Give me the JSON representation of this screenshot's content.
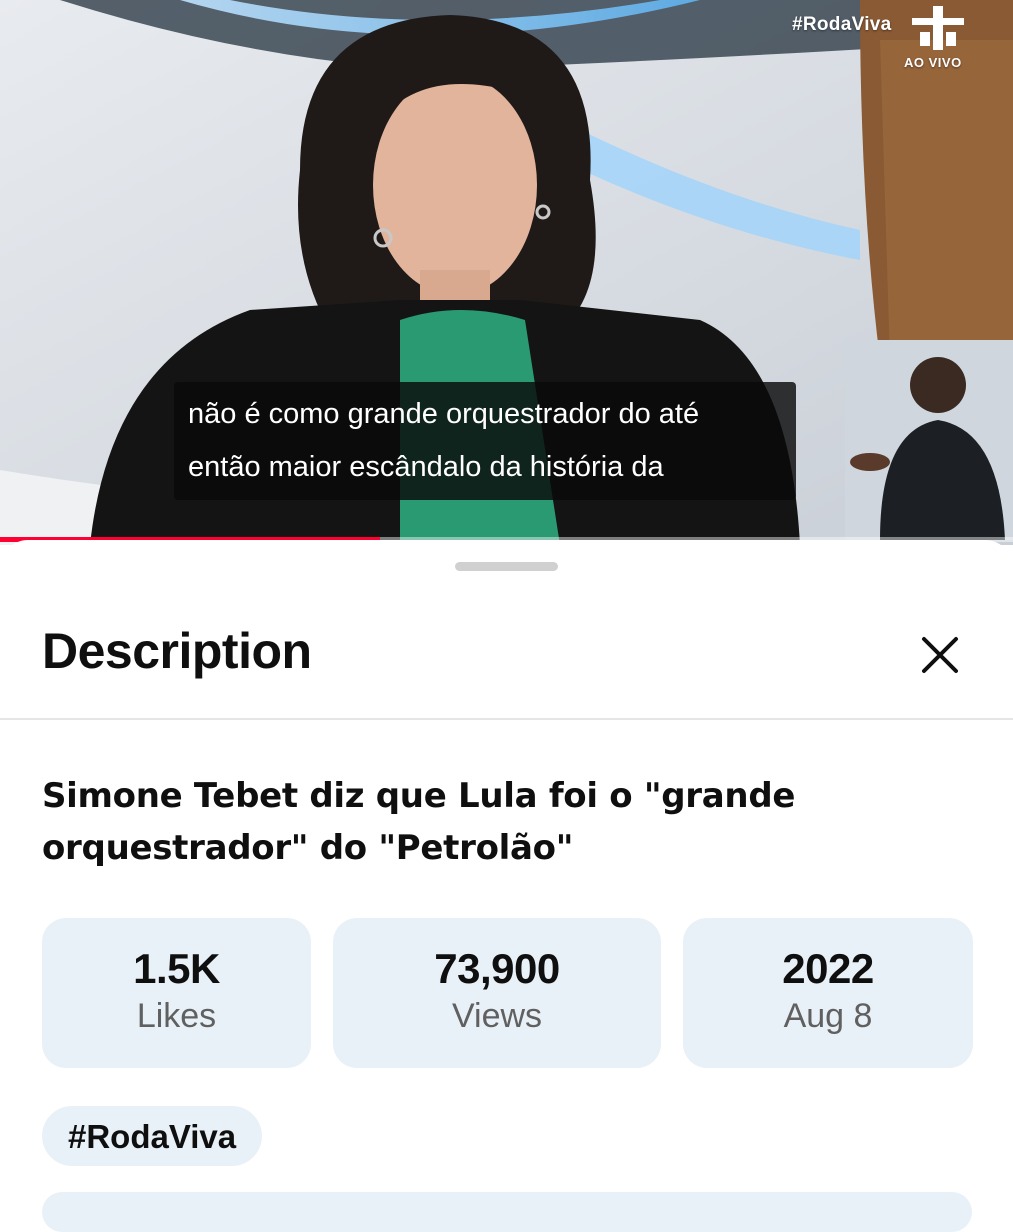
{
  "video": {
    "overlay_hashtag": "#RodaViva",
    "live_label": "AO VIVO",
    "caption_lines": [
      "não é como grande orquestrador do até",
      "então maior escândalo da história da"
    ],
    "progress": 0.375
  },
  "sheet": {
    "title": "Description",
    "video_title": "Simone Tebet diz que Lula foi o \"grande orquestrador\" do \"Petrolão\"",
    "stats": [
      {
        "value": "1.5K",
        "label": "Likes"
      },
      {
        "value": "73,900",
        "label": "Views"
      },
      {
        "value": "2022",
        "label": "Aug 8"
      }
    ],
    "hashtag": "#RodaViva"
  },
  "colors": {
    "accent": "#ff0033",
    "chip_bg": "#e9f1f8",
    "secondary_text": "#606060"
  }
}
